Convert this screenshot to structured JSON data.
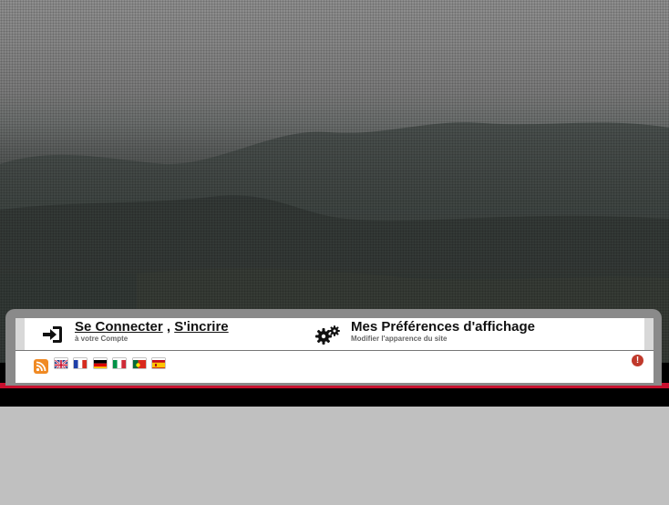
{
  "account": {
    "login_label": "Se Connecter",
    "separator": ",",
    "register_label": "S'incrire",
    "subtitle": "à votre Compte"
  },
  "preferences": {
    "title": "Mes Préférences d'affichage",
    "subtitle": "Modifier l'apparence du site"
  },
  "languages": [
    "English",
    "Français",
    "Deutsch",
    "Italiano",
    "Português",
    "Español"
  ],
  "icons": {
    "login": "sign-in-icon",
    "preferences": "gears-icon",
    "feed": "rss-icon",
    "alert": "exclamation-circle-icon"
  },
  "colors": {
    "accent_red": "#c8102e",
    "frame_grey": "#8a8a8a",
    "rss_orange": "#f08a24",
    "alert_red": "#c0392b"
  }
}
